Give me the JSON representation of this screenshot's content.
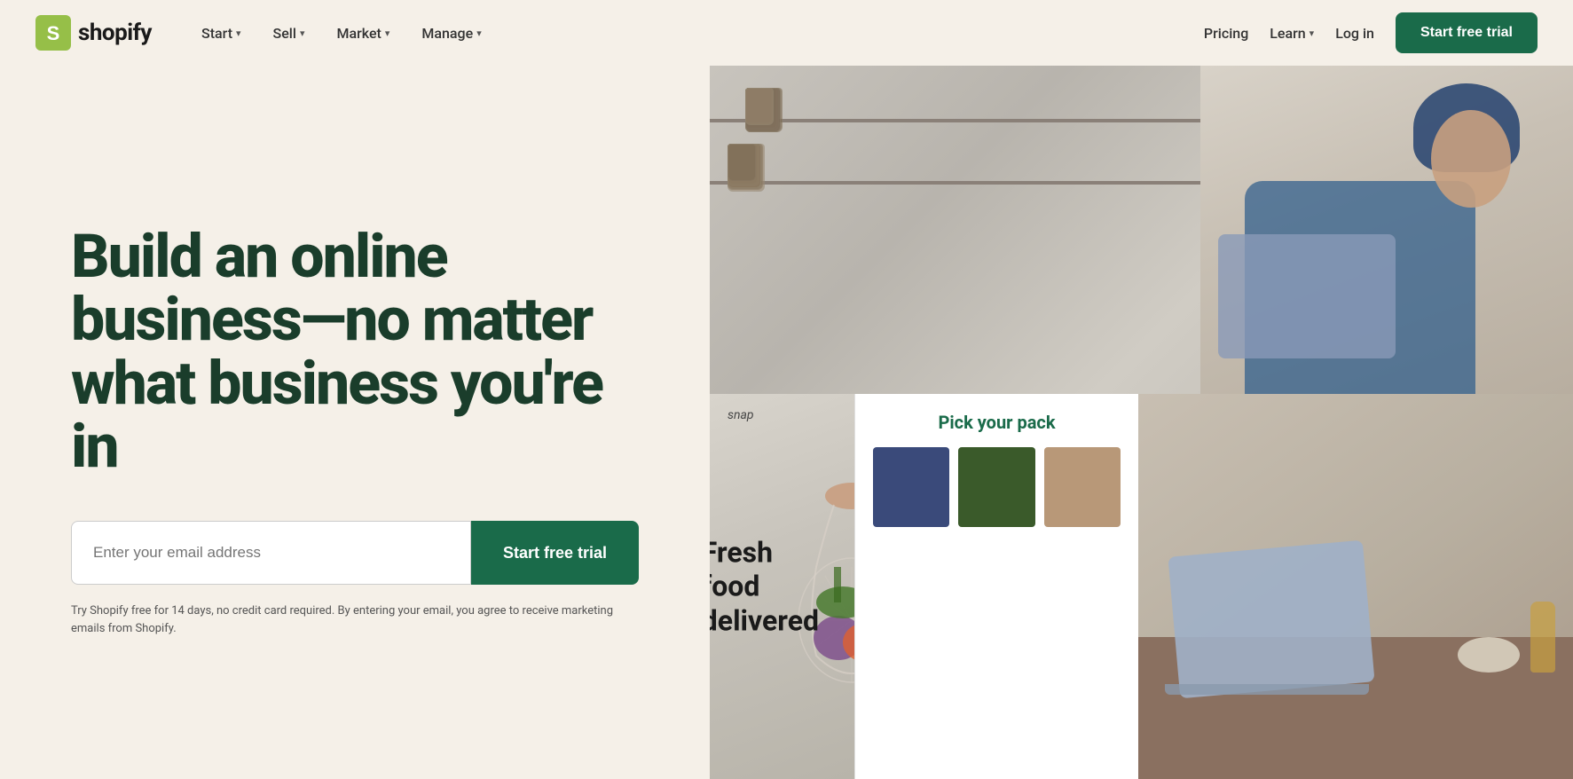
{
  "brand": {
    "name": "shopify",
    "logo_alt": "Shopify logo"
  },
  "nav": {
    "left_items": [
      {
        "label": "Start",
        "has_dropdown": true
      },
      {
        "label": "Sell",
        "has_dropdown": true
      },
      {
        "label": "Market",
        "has_dropdown": true
      },
      {
        "label": "Manage",
        "has_dropdown": true
      }
    ],
    "right_items": [
      {
        "label": "Pricing",
        "has_dropdown": false
      },
      {
        "label": "Learn",
        "has_dropdown": true
      },
      {
        "label": "Log in",
        "has_dropdown": false
      }
    ],
    "cta_label": "Start free trial"
  },
  "hero": {
    "heading": "Build an online business—no matter what business you're in",
    "email_placeholder": "Enter your email address",
    "cta_label": "Start free trial",
    "disclaimer": "Try Shopify free for 14 days, no credit card required. By entering your email, you agree to receive marketing emails from Shopify."
  },
  "images": {
    "snap_label": "snap",
    "fresh_food_title": "Fresh food\ndelivered",
    "pick_pack_title": "Pick your pack"
  },
  "colors": {
    "bg": "#f5f0e8",
    "brand_green": "#1a6b4a",
    "heading_green": "#1a3d2b",
    "swatch_blue": "#3a4a7a",
    "swatch_green_dark": "#3a5a2a",
    "swatch_tan": "#b89878"
  }
}
